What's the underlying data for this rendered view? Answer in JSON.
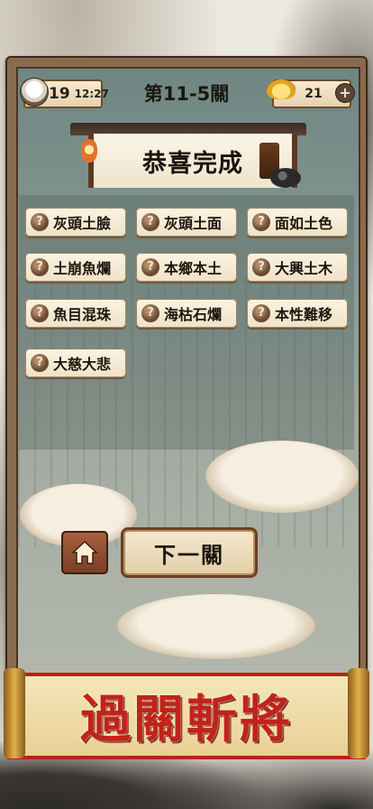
{
  "top_bar": {
    "lives": "19",
    "timer": "12:27",
    "level_title": "第11-5關",
    "coins": "21",
    "icons": {
      "lives": "rice-bowl-icon",
      "coins": "gold-ingot-icon",
      "add": "plus-icon"
    }
  },
  "congrats": {
    "title": "恭喜完成"
  },
  "idioms": [
    "灰頭土臉",
    "灰頭土面",
    "面如土色",
    "土崩魚爛",
    "本鄉本土",
    "大興土木",
    "魚目混珠",
    "海枯石爛",
    "本性難移",
    "大慈大悲"
  ],
  "hint_symbol": "?",
  "buttons": {
    "home_icon": "home-icon",
    "next_label": "下一關"
  },
  "banner": {
    "text": "過關斬將"
  },
  "colors": {
    "banner_text": "#c1231a",
    "frame": "#8a6a4c",
    "panel": "#7f948f"
  }
}
